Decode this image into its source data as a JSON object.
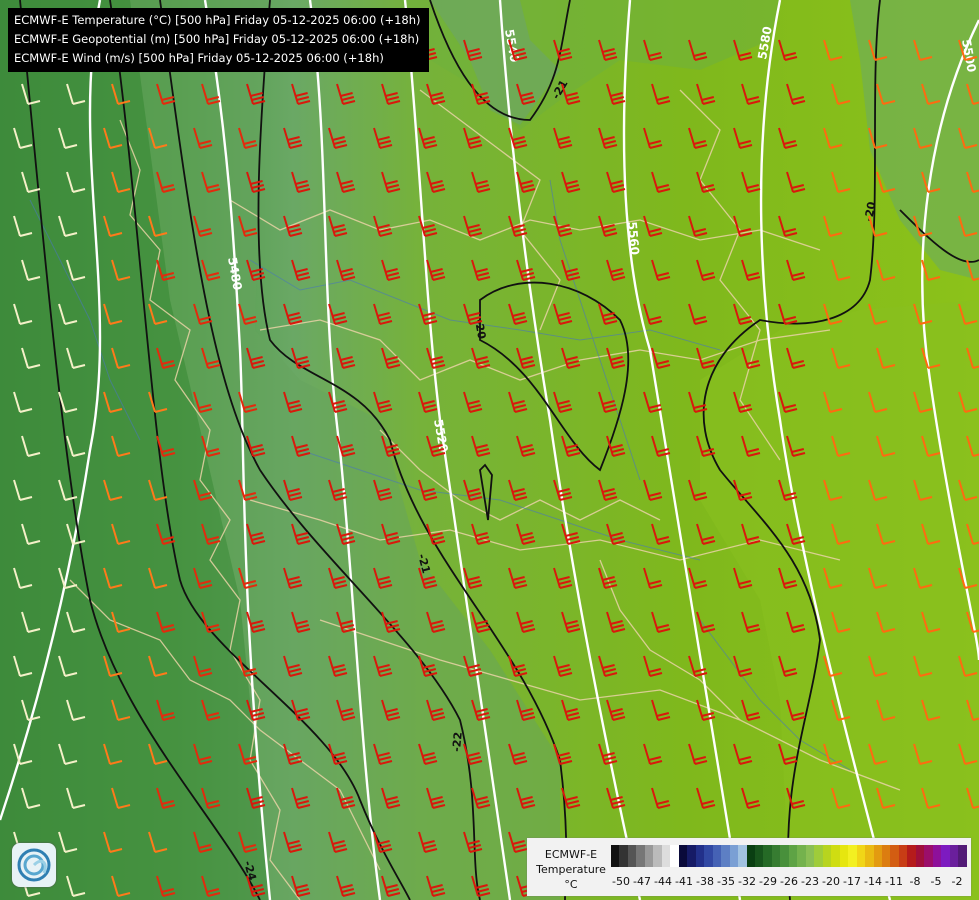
{
  "header": {
    "lines": [
      "ECMWF-E Temperature (°C) [500 hPa] Friday 05-12-2025 06:00 (+18h)",
      "ECMWF-E Geopotential (m) [500 hPa] Friday 05-12-2025 06:00 (+18h)",
      "ECMWF-E Wind (m/s) [500 hPa] Friday 05-12-2025 06:00 (+18h)"
    ]
  },
  "legend": {
    "title_line1": "ECMWF-E",
    "title_line2": "Temperature",
    "unit": "°C",
    "ticks": [
      "-50",
      "-47",
      "-44",
      "-41",
      "-38",
      "-35",
      "-32",
      "-29",
      "-26",
      "-23",
      "-20",
      "-17",
      "-14",
      "-11",
      "-8",
      "-5",
      "-2"
    ],
    "colors": [
      "#111111",
      "#333333",
      "#555555",
      "#777777",
      "#999999",
      "#bbbbbb",
      "#dddddd",
      "#ffffff",
      "#0a0a3a",
      "#161b66",
      "#22308a",
      "#3148a3",
      "#4562b5",
      "#5d7fc4",
      "#7a9fd4",
      "#a2c3e2",
      "#0a3f12",
      "#17541c",
      "#256a26",
      "#367c31",
      "#48903b",
      "#5ea345",
      "#74b24d",
      "#8abf55",
      "#9fcc3a",
      "#b7d41f",
      "#cfdd12",
      "#e6e60f",
      "#f3f021",
      "#f1d617",
      "#eaba12",
      "#e39b10",
      "#dc7d10",
      "#d35d12",
      "#c83d15",
      "#b51b1b",
      "#a00f3a",
      "#9b0e6a",
      "#8e109a",
      "#7d1bc0",
      "#6a1f9c",
      "#521a76"
    ]
  },
  "contours": {
    "geopotential_labels": [
      "5540",
      "5580",
      "5560",
      "5500",
      "5520",
      "5480"
    ],
    "temperature_labels": [
      "-21",
      "-20",
      "-20",
      "-21",
      "-22",
      "-24"
    ]
  },
  "logo": {
    "name": "ecmwf-logo"
  }
}
